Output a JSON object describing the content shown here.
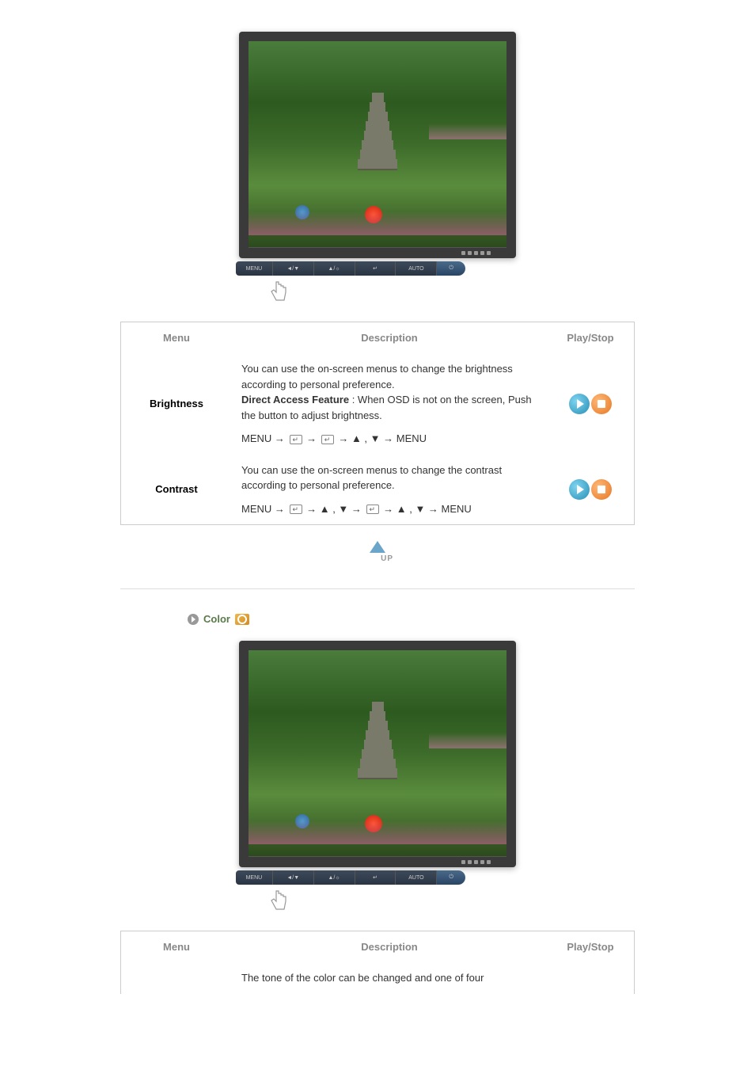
{
  "monitor_buttons": [
    "MENU",
    "◄/▼",
    "▲/☼",
    "↵",
    "AUTO",
    "⏻"
  ],
  "table1": {
    "headers": {
      "menu": "Menu",
      "description": "Description",
      "playstop": "Play/Stop"
    },
    "rows": [
      {
        "name": "Brightness",
        "desc_line1": "You can use the on-screen menus to change the brightness according to personal preference.",
        "desc_bold": "Direct Access Feature",
        "desc_after_bold": " : When OSD is not on the screen, Push the button to adjust brightness.",
        "nav_prefix": "MENU → ",
        "nav_mid": " → ",
        "nav_mid2": " → ▲ , ▼ → MENU"
      },
      {
        "name": "Contrast",
        "desc_line1": "You can use the on-screen menus to change the contrast according to personal preference.",
        "nav_prefix": "MENU → ",
        "nav_mid": " → ▲ , ▼ → ",
        "nav_mid2": " → ▲ , ▼ → MENU"
      }
    ]
  },
  "up_label": "UP",
  "section2": {
    "title": "Color"
  },
  "table2": {
    "headers": {
      "menu": "Menu",
      "description": "Description",
      "playstop": "Play/Stop"
    },
    "partial_row": {
      "desc": "The tone of the color can be changed and one of four"
    }
  }
}
